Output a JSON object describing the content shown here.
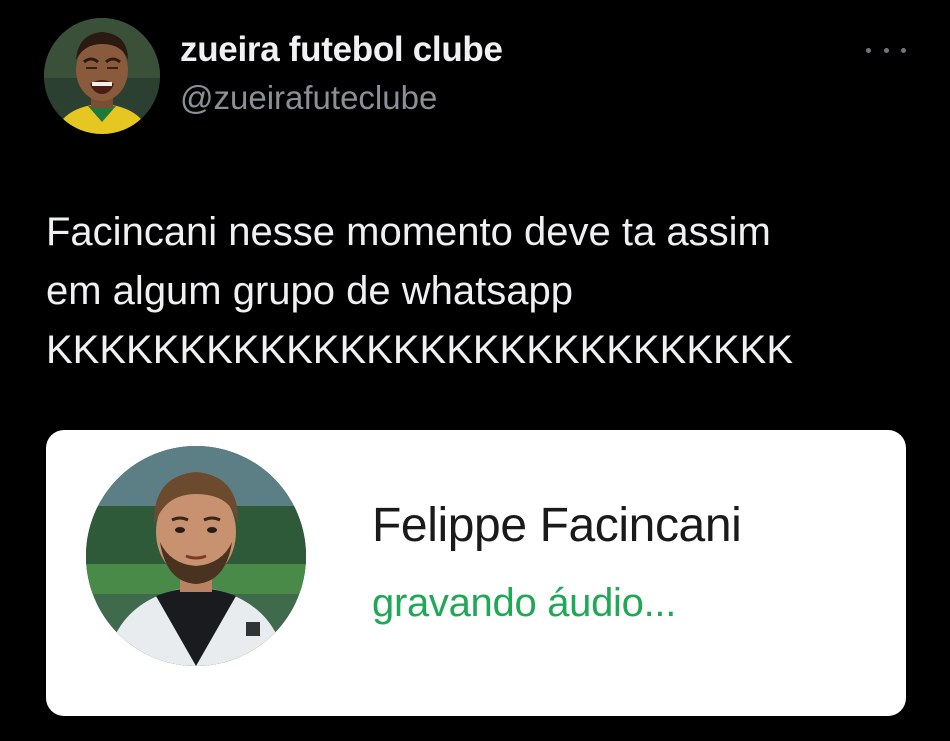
{
  "tweet": {
    "author": {
      "display_name": "zueira futebol clube",
      "handle": "@zueirafuteclube",
      "avatar_icon": "profile-photo"
    },
    "more_icon": "more-horizontal-icon",
    "text": "Facincani nesse momento deve ta assim\nem algum grupo de whatsapp\nKKKKKKKKKKKKKKKKKKKKKKKKKKKK"
  },
  "media": {
    "contact": {
      "name": "Felippe Facincani",
      "status": "gravando áudio..."
    }
  },
  "colors": {
    "background": "#000000",
    "name_text": "#f0f1f2",
    "handle_text": "#8b9096",
    "status_green": "#1fa855",
    "card_background": "#ffffff"
  }
}
